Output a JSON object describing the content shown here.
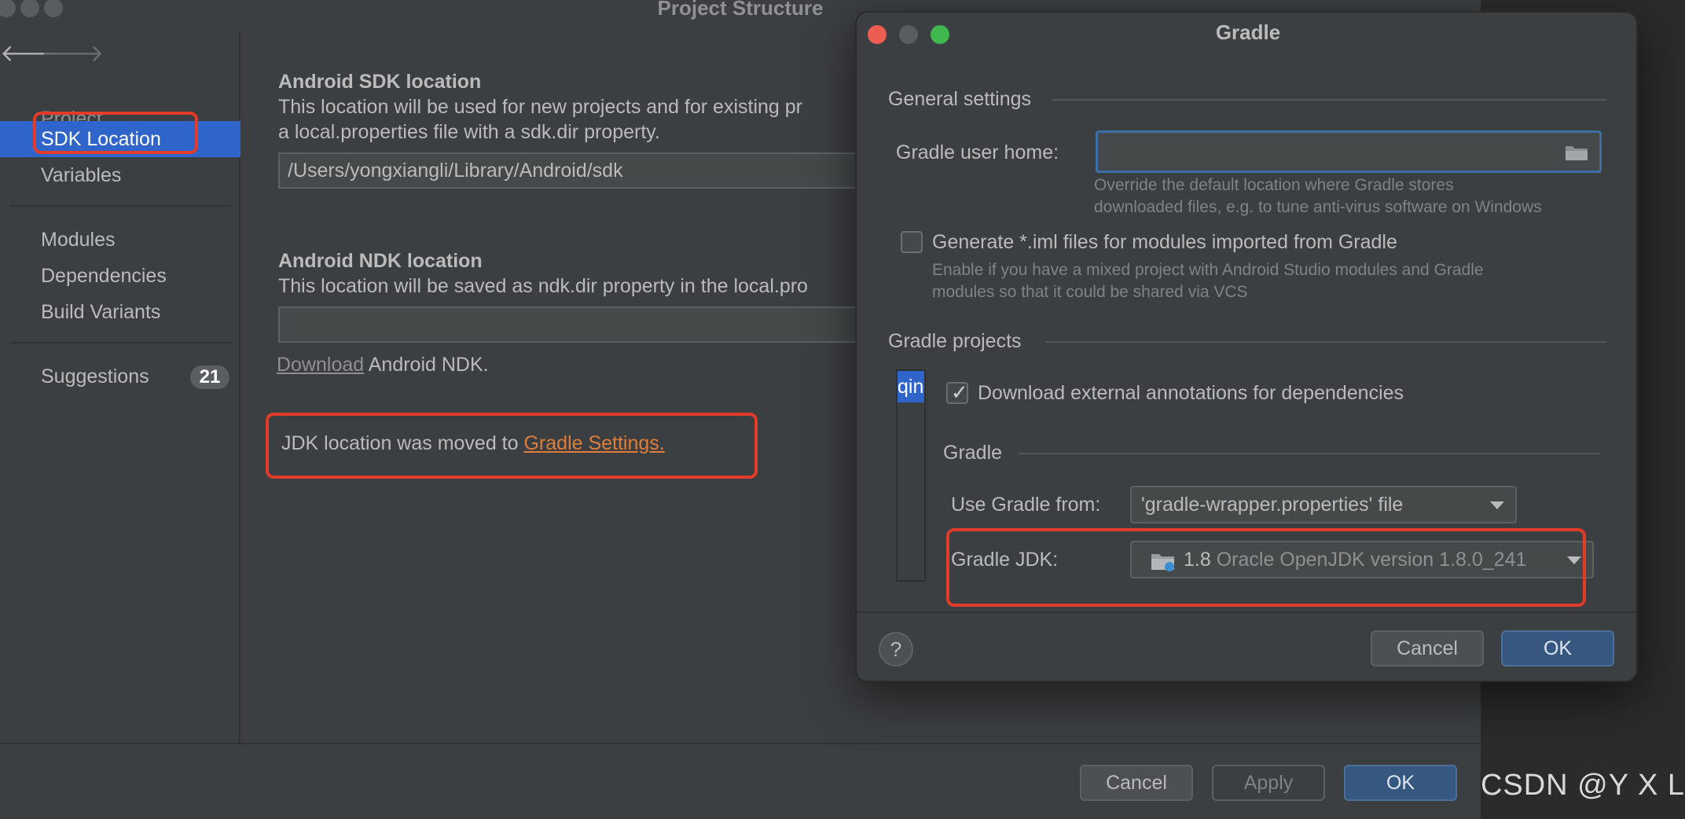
{
  "project_structure": {
    "title": "Project Structure",
    "nav_back": "🡐",
    "nav_forward": "🡒",
    "sidebar": {
      "items": [
        {
          "label": "Project"
        },
        {
          "label": "SDK Location"
        },
        {
          "label": "Variables"
        },
        {
          "label": "Modules"
        },
        {
          "label": "Dependencies"
        },
        {
          "label": "Build Variants"
        },
        {
          "label": "Suggestions",
          "badge": "21"
        }
      ]
    },
    "sdk": {
      "heading": "Android SDK location",
      "desc_line1": "This location will be used for new projects and for existing pr",
      "desc_line2": "a local.properties file with a sdk.dir property.",
      "path": "/Users/yongxiangli/Library/Android/sdk"
    },
    "ndk": {
      "heading": "Android NDK location",
      "desc": "This location will be saved as ndk.dir property in the local.pro",
      "path": "",
      "download_link": "Download",
      "download_suffix": " Android NDK."
    },
    "jdk_notice": {
      "text": "JDK location was moved to ",
      "link": "Gradle Settings."
    },
    "footer": {
      "cancel": "Cancel",
      "apply": "Apply",
      "ok": "OK"
    }
  },
  "gradle_dialog": {
    "title": "Gradle",
    "general_settings": "General settings",
    "user_home_label": "Gradle user home:",
    "user_home_value": "",
    "user_home_hint_1": "Override the default location where Gradle stores",
    "user_home_hint_2": "downloaded files, e.g. to tune anti-virus software on Windows",
    "generate_iml_label": "Generate *.iml files for modules imported from Gradle",
    "generate_iml_hint_1": "Enable if you have a mixed project with Android Studio modules and Gradle",
    "generate_iml_hint_2": "modules so that it could be shared via VCS",
    "gradle_projects": "Gradle projects",
    "project_item": "qin",
    "download_annotations_label": "Download external annotations for dependencies",
    "gradle_group": "Gradle",
    "use_gradle_from_label": "Use Gradle from:",
    "use_gradle_from_value": "'gradle-wrapper.properties' file",
    "gradle_jdk_label": "Gradle JDK:",
    "gradle_jdk_version": "1.8",
    "gradle_jdk_detail": " Oracle OpenJDK version 1.8.0_241",
    "help": "?",
    "cancel": "Cancel",
    "ok": "OK"
  },
  "watermark": "CSDN @Y X L",
  "colors": {
    "selection": "#2f65ca",
    "highlight_border": "#e23b2a",
    "link_orange": "#e07d3b",
    "close": "#ee5d52",
    "minimize": "#5a5d60",
    "zoom": "#3fb94f"
  }
}
